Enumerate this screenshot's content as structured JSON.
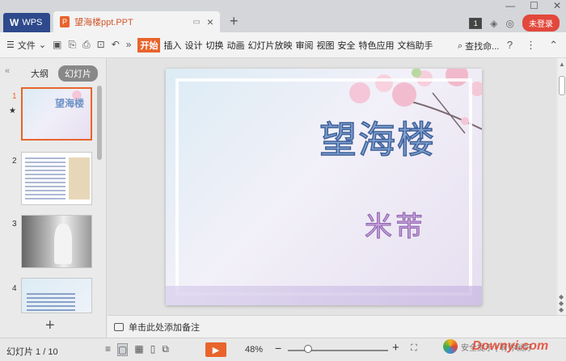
{
  "titlebar": {
    "app_label": "WPS",
    "doc_tab": "望海楼ppt.PPT",
    "login": "未登录",
    "badge": "1"
  },
  "toolbar": {
    "file_menu": "文件",
    "tabs": [
      "开始",
      "插入",
      "设计",
      "切换",
      "动画",
      "幻灯片放映",
      "审阅",
      "视图",
      "安全",
      "特色应用",
      "文档助手"
    ],
    "active_tab": "开始",
    "search": "查找命..."
  },
  "leftpanel": {
    "tab_outline": "大纲",
    "tab_slides": "幻灯片",
    "thumbs": [
      {
        "num": "1",
        "title": "望海楼"
      },
      {
        "num": "2"
      },
      {
        "num": "3"
      },
      {
        "num": "4"
      }
    ]
  },
  "slide": {
    "title": "望海楼",
    "subtitle": "米芾"
  },
  "notes": {
    "placeholder": "单击此处添加备注"
  },
  "status": {
    "slide_counter": "幻灯片 1 / 10",
    "zoom": "48%",
    "zoom_fraction": 0.48
  },
  "watermark": {
    "site": "Downyi.com",
    "tip": "安全提示 | 有你就好"
  },
  "colors": {
    "accent": "#e8642c",
    "wps_tab": "#2e4a8c",
    "login_bg": "#e2483b"
  }
}
